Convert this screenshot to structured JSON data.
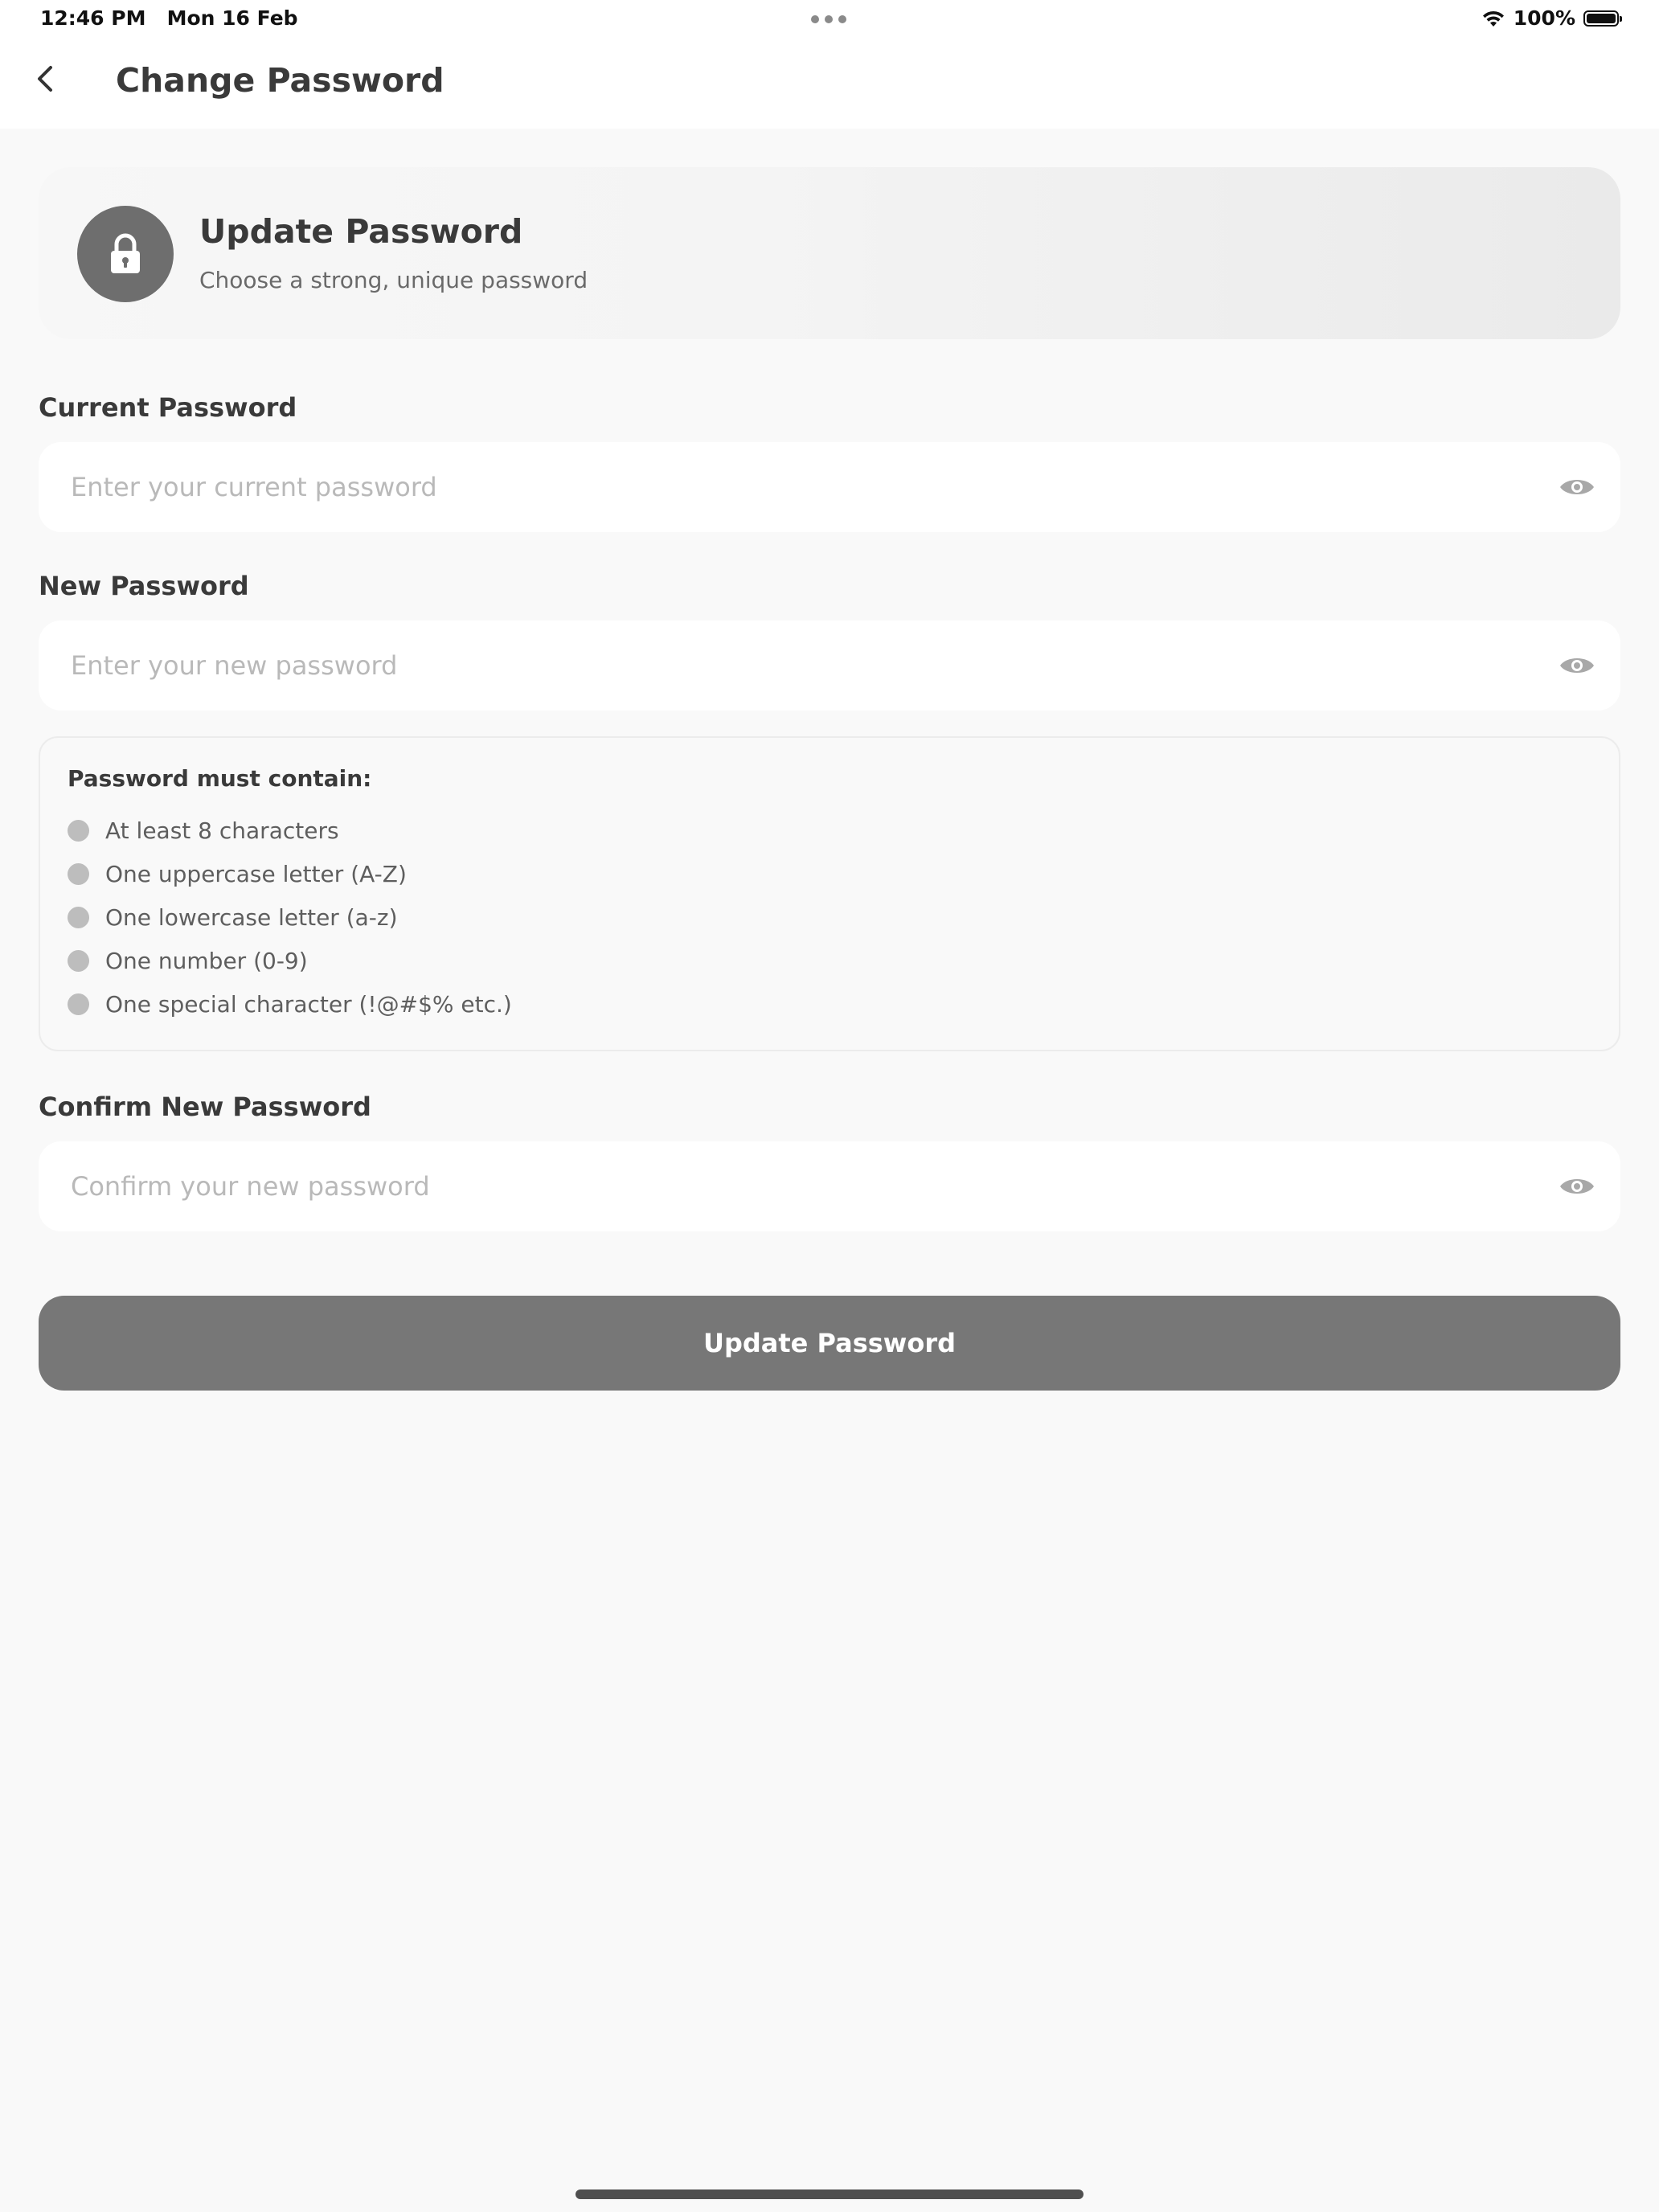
{
  "status_bar": {
    "time": "12:46 PM",
    "date": "Mon 16 Feb",
    "battery": "100%",
    "battery_level": 1.0
  },
  "nav": {
    "title": "Change Password",
    "back_icon": "chevron-left-icon"
  },
  "hero": {
    "icon": "lock-icon",
    "title": "Update Password",
    "subtitle": "Choose a strong, unique password"
  },
  "fields": {
    "current": {
      "label": "Current Password",
      "placeholder": "Enter your current password",
      "value": ""
    },
    "new": {
      "label": "New Password",
      "placeholder": "Enter your new password",
      "value": ""
    },
    "confirm": {
      "label": "Confirm New Password",
      "placeholder": "Confirm your new password",
      "value": ""
    }
  },
  "requirements": {
    "title": "Password must contain:",
    "items": [
      "At least 8 characters",
      "One uppercase letter (A-Z)",
      "One lowercase letter (a-z)",
      "One number (0-9)",
      "One special character (!@#$% etc.)"
    ]
  },
  "submit": {
    "label": "Update Password"
  },
  "colors": {
    "background": "#f9f9f9",
    "button": "#777777",
    "icon_circle": "#6e6e6e",
    "requirement_dot": "#bdbdbd",
    "placeholder": "#b9b9b9"
  }
}
